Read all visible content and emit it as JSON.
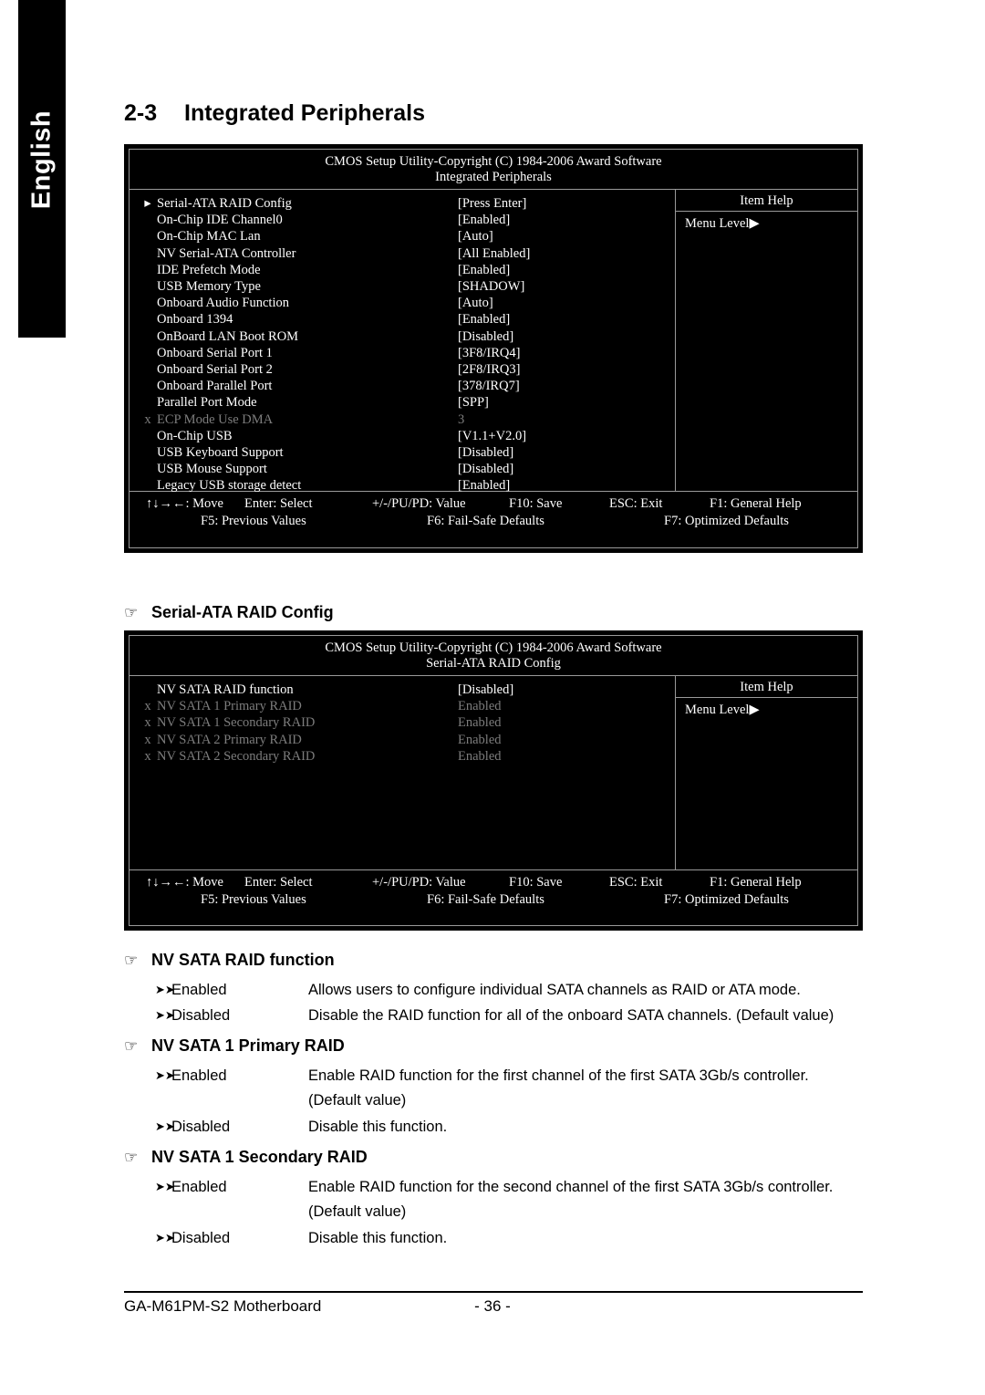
{
  "side_tab": {
    "label": "English"
  },
  "section": {
    "number": "2-3",
    "title": "Integrated Peripherals"
  },
  "bios1": {
    "title_line1": "CMOS Setup Utility-Copyright (C) 1984-2006 Award Software",
    "title_line2": "Integrated Peripherals",
    "item_help_title": "Item Help",
    "menu_level": "Menu Level",
    "menu_level_arrow": "▶",
    "rows": [
      {
        "mark": "▸",
        "name": "Serial-ATA RAID Config",
        "value": "[Press Enter]",
        "dim": false
      },
      {
        "mark": "",
        "name": "On-Chip IDE Channel0",
        "value": "[Enabled]",
        "dim": false
      },
      {
        "mark": "",
        "name": "On-Chip MAC Lan",
        "value": "[Auto]",
        "dim": false
      },
      {
        "mark": "",
        "name": "NV Serial-ATA Controller",
        "value": "[All Enabled]",
        "dim": false
      },
      {
        "mark": "",
        "name": "IDE Prefetch Mode",
        "value": "[Enabled]",
        "dim": false
      },
      {
        "mark": "",
        "name": "USB Memory Type",
        "value": "[SHADOW]",
        "dim": false
      },
      {
        "mark": "",
        "name": "Onboard Audio Function",
        "value": "[Auto]",
        "dim": false
      },
      {
        "mark": "",
        "name": "Onboard 1394",
        "value": "[Enabled]",
        "dim": false
      },
      {
        "mark": "",
        "name": "OnBoard LAN Boot ROM",
        "value": "[Disabled]",
        "dim": false
      },
      {
        "mark": "",
        "name": "Onboard Serial Port 1",
        "value": "[3F8/IRQ4]",
        "dim": false
      },
      {
        "mark": "",
        "name": "Onboard Serial Port 2",
        "value": "[2F8/IRQ3]",
        "dim": false
      },
      {
        "mark": "",
        "name": "Onboard Parallel Port",
        "value": "[378/IRQ7]",
        "dim": false
      },
      {
        "mark": "",
        "name": "Parallel Port Mode",
        "value": "[SPP]",
        "dim": false
      },
      {
        "mark": "x",
        "name": "ECP Mode Use DMA",
        "value": "3",
        "dim": true
      },
      {
        "mark": "",
        "name": "On-Chip USB",
        "value": "[V1.1+V2.0]",
        "dim": false
      },
      {
        "mark": "",
        "name": "USB Keyboard Support",
        "value": "[Disabled]",
        "dim": false
      },
      {
        "mark": "",
        "name": "USB Mouse Support",
        "value": "[Disabled]",
        "dim": false
      },
      {
        "mark": "",
        "name": "Legacy USB storage detect",
        "value": "[Enabled]",
        "dim": false
      }
    ],
    "footer": {
      "line1": [
        "↑↓→←: Move",
        "Enter: Select",
        "+/-/PU/PD: Value",
        "F10: Save",
        "ESC: Exit",
        "F1: General Help"
      ],
      "line2": [
        "F5: Previous Values",
        "F6: Fail-Safe Defaults",
        "F7: Optimized Defaults"
      ]
    }
  },
  "sub1": {
    "hand": "☞",
    "title": "Serial-ATA RAID Config"
  },
  "bios2": {
    "title_line1": "CMOS Setup Utility-Copyright (C) 1984-2006 Award Software",
    "title_line2": "Serial-ATA RAID Config",
    "item_help_title": "Item Help",
    "menu_level": "Menu Level",
    "menu_level_arrow": "▶",
    "rows": [
      {
        "mark": "",
        "name": "NV SATA RAID function",
        "value": "[Disabled]",
        "dim": false
      },
      {
        "mark": "x",
        "name": "NV SATA 1 Primary RAID",
        "value": "Enabled",
        "dim": true
      },
      {
        "mark": "x",
        "name": "NV SATA 1 Secondary RAID",
        "value": "Enabled",
        "dim": true
      },
      {
        "mark": "x",
        "name": "NV SATA 2 Primary RAID",
        "value": "Enabled",
        "dim": true
      },
      {
        "mark": "x",
        "name": "NV SATA 2 Secondary RAID",
        "value": "Enabled",
        "dim": true
      }
    ],
    "footer": {
      "line1": [
        "↑↓→←: Move",
        "Enter: Select",
        "+/-/PU/PD: Value",
        "F10: Save",
        "ESC: Exit",
        "F1: General Help"
      ],
      "line2": [
        "F5: Previous Values",
        "F6: Fail-Safe Defaults",
        "F7: Optimized Defaults"
      ]
    }
  },
  "sections": [
    {
      "hand": "☞",
      "title": "NV SATA RAID function",
      "options": [
        {
          "arrow": "➤➤",
          "label": "Enabled",
          "desc": "Allows users to configure individual SATA channels as RAID or ATA mode.",
          "cont": ""
        },
        {
          "arrow": "➤➤",
          "label": "Disabled",
          "desc": "Disable the RAID function for all of the onboard SATA channels. (Default value)",
          "cont": ""
        }
      ]
    },
    {
      "hand": "☞",
      "title": "NV SATA 1 Primary RAID",
      "options": [
        {
          "arrow": "➤➤",
          "label": "Enabled",
          "desc": "Enable RAID function for the first channel of the first SATA 3Gb/s controller.",
          "cont": "(Default value)"
        },
        {
          "arrow": "➤➤",
          "label": "Disabled",
          "desc": "Disable this function.",
          "cont": ""
        }
      ]
    },
    {
      "hand": "☞",
      "title": "NV SATA 1 Secondary RAID",
      "options": [
        {
          "arrow": "➤➤",
          "label": "Enabled",
          "desc": "Enable RAID function for the second channel of the first SATA 3Gb/s controller.",
          "cont": "(Default value)"
        },
        {
          "arrow": "➤➤",
          "label": "Disabled",
          "desc": "Disable this function.",
          "cont": ""
        }
      ]
    }
  ],
  "page_footer": {
    "left": "GA-M61PM-S2 Motherboard",
    "center": "- 36 -"
  }
}
